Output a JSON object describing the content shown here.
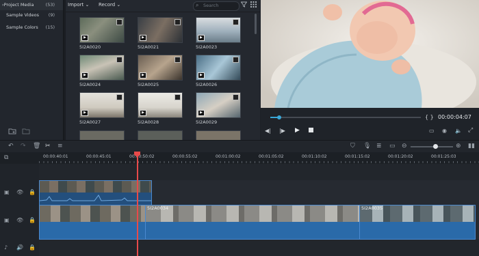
{
  "sidebar": {
    "items": [
      {
        "label": "Project Media",
        "count": "(53)",
        "prefix": "›"
      },
      {
        "label": "Sample Videos",
        "count": "(9)"
      },
      {
        "label": "Sample Colors",
        "count": "(15)"
      }
    ]
  },
  "toolbar": {
    "import_label": "Import",
    "record_label": "Record",
    "search_placeholder": "Search"
  },
  "media": [
    {
      "name": "5I2A0020"
    },
    {
      "name": "5I2A0021"
    },
    {
      "name": "5I2A0023"
    },
    {
      "name": "5I2A0024"
    },
    {
      "name": "5I2A0025"
    },
    {
      "name": "5I2A0026"
    },
    {
      "name": "5I2A0027"
    },
    {
      "name": "5I2A0028"
    },
    {
      "name": "5I2A0029"
    }
  ],
  "preview": {
    "timecode": "00:00:04:07",
    "brackets": "{ }",
    "progress": 0.06
  },
  "timeline": {
    "ruler": [
      "00:00:40:01",
      "00:00:45:01",
      "00:00:50:02",
      "00:00:55:02",
      "00:01:00:02",
      "00:01:05:02",
      "00:01:10:02",
      "00:01:15:02",
      "00:01:20:02",
      "00:01:25:03"
    ],
    "clip_labels": [
      "5I2A0034",
      "5I2A0035"
    ],
    "zoom_level": 0.58
  },
  "colors": {
    "accent": "#3aa8d8",
    "playhead": "#e84a4a",
    "audio_waveform": "#2e6fb0"
  }
}
